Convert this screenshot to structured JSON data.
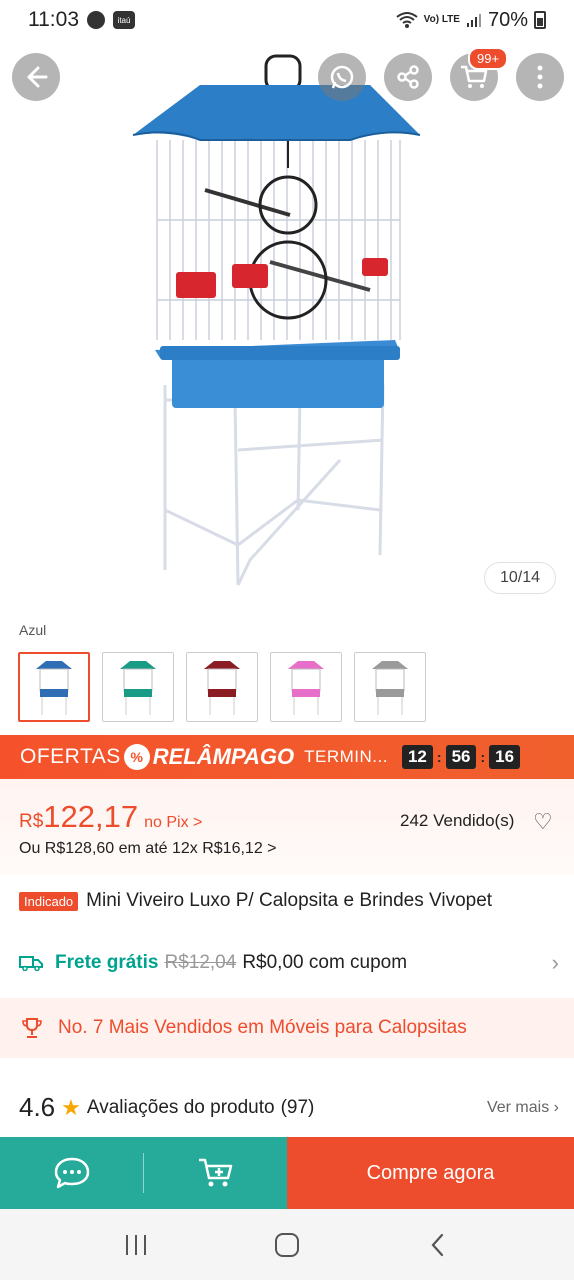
{
  "status_bar": {
    "time": "11:03",
    "bank_label": "itaú",
    "network": "Vo) LTE",
    "battery": "70%"
  },
  "gallery": {
    "cart_badge": "99+",
    "page_counter": "10/14"
  },
  "variation": {
    "label": "Azul",
    "options_colors": [
      "#2f6db5",
      "#1a9b86",
      "#8b1c24",
      "#e86fc9",
      "#9a9a9a"
    ],
    "selected_index": 0
  },
  "flash_sale": {
    "ofertas": "OFERTAS",
    "relampago": "RELÂMPAGO",
    "termina": "TERMIN...",
    "hours": "12",
    "minutes": "56",
    "seconds": "16"
  },
  "price": {
    "currency": "R$",
    "value": "122,17",
    "pix_label": "no Pix >",
    "sold": "242 Vendido(s)",
    "installments": "Ou R$128,60 em até 12x R$16,12 >"
  },
  "product": {
    "badge": "Indicado",
    "title": "Mini Viveiro Luxo P/ Calopsita e Brindes Vivopet"
  },
  "shipping": {
    "label": "Frete grátis",
    "old_price": "R$12,04",
    "new_price": "R$0,00 com cupom"
  },
  "ranking": {
    "text": "No. 7 Mais Vendidos em Móveis para Calopsitas"
  },
  "reviews": {
    "rating": "4.6",
    "label": "Avaliações do produto",
    "count": "(97)",
    "see_more": "Ver mais"
  },
  "actions": {
    "buy_now": "Compre agora"
  },
  "colors": {
    "brand": "#ee4d2d",
    "teal": "#26aa99",
    "free_shipping": "#00a38f"
  }
}
